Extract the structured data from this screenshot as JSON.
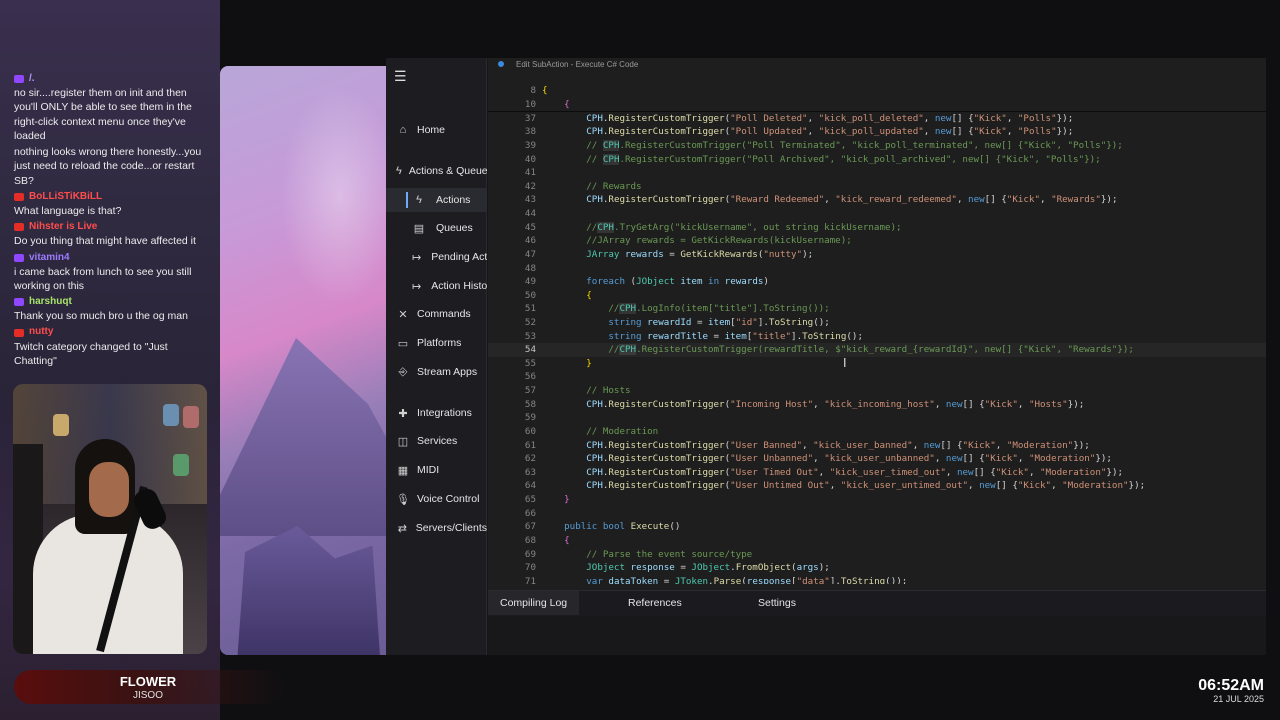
{
  "chat": [
    {
      "platform": "twitch",
      "user": "/.",
      "user_color": "#b497ff",
      "text": "no sir....register them on init and then you'll ONLY be able to see them in the right-click context menu once they've loaded"
    },
    {
      "platform": "",
      "user": "",
      "user_color": "#ffffff",
      "text": "nothing looks wrong there honestly...you just need to reload the code...or restart SB?"
    },
    {
      "platform": "youtube",
      "user": "BoLLiSTiKBiLL",
      "user_color": "#ff4d4d",
      "text": "What language is that?"
    },
    {
      "platform": "youtube",
      "user": "Nihster is Live",
      "user_color": "#ff4d4d",
      "text": "Do you thing that might have affected it"
    },
    {
      "platform": "twitch",
      "user": "vitamin4",
      "user_color": "#9c7bff",
      "text": "i came back from lunch to see you still working on this"
    },
    {
      "platform": "twitch",
      "user": "harshuqt",
      "user_color": "#a6e36b",
      "text": "Thank you so much bro u the og man"
    },
    {
      "platform": "youtube",
      "user": "nutty",
      "user_color": "#ff4d4d",
      "text": "Twitch category changed to \"Just Chatting\""
    }
  ],
  "now_playing": {
    "title": "FLOWER",
    "artist": "JISOO"
  },
  "clock": {
    "time": "06:52AM",
    "date": "21 JUL 2025"
  },
  "sidebar": {
    "items": [
      {
        "label": "Home",
        "icon": "home-icon",
        "glyph": "⌂",
        "sub": false,
        "active": false
      },
      {
        "label": "Actions & Queues",
        "icon": "bolt-icon",
        "glyph": "ϟ",
        "sub": false,
        "active": false
      },
      {
        "label": "Actions",
        "icon": "bolt-icon",
        "glyph": "ϟ",
        "sub": true,
        "active": true
      },
      {
        "label": "Queues",
        "icon": "queue-icon",
        "glyph": "▤",
        "sub": true,
        "active": false
      },
      {
        "label": "Pending Actions",
        "icon": "pending-icon",
        "glyph": "↦",
        "sub": true,
        "active": false
      },
      {
        "label": "Action History",
        "icon": "history-icon",
        "glyph": "↦",
        "sub": true,
        "active": false
      },
      {
        "label": "Commands",
        "icon": "commands-icon",
        "glyph": "✕",
        "sub": false,
        "active": false
      },
      {
        "label": "Platforms",
        "icon": "platforms-icon",
        "glyph": "▭",
        "sub": false,
        "active": false
      },
      {
        "label": "Stream Apps",
        "icon": "stream-apps-icon",
        "glyph": "⎆",
        "sub": false,
        "active": false
      },
      {
        "label": "Integrations",
        "icon": "integrations-icon",
        "glyph": "✚",
        "sub": false,
        "active": false
      },
      {
        "label": "Services",
        "icon": "services-icon",
        "glyph": "◫",
        "sub": false,
        "active": false
      },
      {
        "label": "MIDI",
        "icon": "midi-icon",
        "glyph": "▦",
        "sub": false,
        "active": false
      },
      {
        "label": "Voice Control",
        "icon": "voice-icon",
        "glyph": "🎙",
        "sub": false,
        "active": false
      },
      {
        "label": "Servers/Clients",
        "icon": "servers-icon",
        "glyph": "⇄",
        "sub": false,
        "active": false
      }
    ]
  },
  "editor": {
    "title": "Edit SubAction - Execute C# Code",
    "lines": [
      {
        "n": "8",
        "html": "<span class='br'>{</span>"
      },
      {
        "n": "10",
        "html": "    <span class='br2'>{</span>"
      },
      {
        "n": "37",
        "html": "        <span class='vr'>CPH</span>.<span class='fn'>RegisterCustomTrigger</span>(<span class='st'>\"Poll Deleted\"</span>, <span class='st'>\"kick_poll_deleted\"</span>, <span class='kw'>new</span>[] {<span class='st'>\"Kick\"</span>, <span class='st'>\"Polls\"</span>});"
      },
      {
        "n": "38",
        "html": "        <span class='vr'>CPH</span>.<span class='fn'>RegisterCustomTrigger</span>(<span class='st'>\"Poll Updated\"</span>, <span class='st'>\"kick_poll_updated\"</span>, <span class='kw'>new</span>[] {<span class='st'>\"Kick\"</span>, <span class='st'>\"Polls\"</span>});"
      },
      {
        "n": "39",
        "html": "        <span class='cm'>// <span class='cph'>CPH</span>.RegisterCustomTrigger(\"Poll Terminated\", \"kick_poll_terminated\", new[] {\"Kick\", \"Polls\"});</span>"
      },
      {
        "n": "40",
        "html": "        <span class='cm'>// <span class='cph'>CPH</span>.RegisterCustomTrigger(\"Poll Archived\", \"kick_poll_archived\", new[] {\"Kick\", \"Polls\"});</span>"
      },
      {
        "n": "41",
        "html": ""
      },
      {
        "n": "42",
        "html": "        <span class='cm'>// Rewards</span>"
      },
      {
        "n": "43",
        "html": "        <span class='vr'>CPH</span>.<span class='fn'>RegisterCustomTrigger</span>(<span class='st'>\"Reward Redeemed\"</span>, <span class='st'>\"kick_reward_redeemed\"</span>, <span class='kw'>new</span>[] {<span class='st'>\"Kick\"</span>, <span class='st'>\"Rewards\"</span>});"
      },
      {
        "n": "44",
        "html": ""
      },
      {
        "n": "45",
        "html": "        <span class='cm'>//<span class='cph'>CPH</span>.TryGetArg(\"kickUsername\", out string kickUsername);</span>"
      },
      {
        "n": "46",
        "html": "        <span class='cm'>//JArray rewards = GetKickRewards(kickUsername);</span>"
      },
      {
        "n": "47",
        "html": "        <span class='ty'>JArray</span> <span class='vr'>rewards</span> = <span class='fn'>GetKickRewards</span>(<span class='st'>\"nutty\"</span>);"
      },
      {
        "n": "48",
        "html": ""
      },
      {
        "n": "49",
        "html": "        <span class='kw'>foreach</span> (<span class='ty'>JObject</span> <span class='vr'>item</span> <span class='kw'>in</span> <span class='vr'>rewards</span>)"
      },
      {
        "n": "50",
        "html": "        <span class='br'>{</span>"
      },
      {
        "n": "51",
        "html": "            <span class='cm'>//<span class='cph'>CPH</span>.LogInfo(item[\"title\"].ToString());</span>"
      },
      {
        "n": "52",
        "html": "            <span class='kw'>string</span> <span class='vr'>rewardId</span> = <span class='vr'>item</span>[<span class='st'>\"id\"</span>].<span class='fn'>ToString</span>();"
      },
      {
        "n": "53",
        "html": "            <span class='kw'>string</span> <span class='vr'>rewardTitle</span> = <span class='vr'>item</span>[<span class='st'>\"title\"</span>].<span class='fn'>ToString</span>();"
      },
      {
        "n": "54",
        "html": "            <span class='cm'>//<span class='cph'>CPH</span>.RegisterCustomTrigger(rewardTitle, $\"kick_reward_{rewardId}\", new[] {\"Kick\", \"Rewards\"});</span>",
        "active": true
      },
      {
        "n": "55",
        "html": "        <span class='br'>}</span>"
      },
      {
        "n": "56",
        "html": ""
      },
      {
        "n": "57",
        "html": "        <span class='cm'>// Hosts</span>"
      },
      {
        "n": "58",
        "html": "        <span class='vr'>CPH</span>.<span class='fn'>RegisterCustomTrigger</span>(<span class='st'>\"Incoming Host\"</span>, <span class='st'>\"kick_incoming_host\"</span>, <span class='kw'>new</span>[] {<span class='st'>\"Kick\"</span>, <span class='st'>\"Hosts\"</span>});"
      },
      {
        "n": "59",
        "html": ""
      },
      {
        "n": "60",
        "html": "        <span class='cm'>// Moderation</span>"
      },
      {
        "n": "61",
        "html": "        <span class='vr'>CPH</span>.<span class='fn'>RegisterCustomTrigger</span>(<span class='st'>\"User Banned\"</span>, <span class='st'>\"kick_user_banned\"</span>, <span class='kw'>new</span>[] {<span class='st'>\"Kick\"</span>, <span class='st'>\"Moderation\"</span>});"
      },
      {
        "n": "62",
        "html": "        <span class='vr'>CPH</span>.<span class='fn'>RegisterCustomTrigger</span>(<span class='st'>\"User Unbanned\"</span>, <span class='st'>\"kick_user_unbanned\"</span>, <span class='kw'>new</span>[] {<span class='st'>\"Kick\"</span>, <span class='st'>\"Moderation\"</span>});"
      },
      {
        "n": "63",
        "html": "        <span class='vr'>CPH</span>.<span class='fn'>RegisterCustomTrigger</span>(<span class='st'>\"User Timed Out\"</span>, <span class='st'>\"kick_user_timed_out\"</span>, <span class='kw'>new</span>[] {<span class='st'>\"Kick\"</span>, <span class='st'>\"Moderation\"</span>});"
      },
      {
        "n": "64",
        "html": "        <span class='vr'>CPH</span>.<span class='fn'>RegisterCustomTrigger</span>(<span class='st'>\"User Untimed Out\"</span>, <span class='st'>\"kick_user_untimed_out\"</span>, <span class='kw'>new</span>[] {<span class='st'>\"Kick\"</span>, <span class='st'>\"Moderation\"</span>});"
      },
      {
        "n": "65",
        "html": "    <span class='br2'>}</span>"
      },
      {
        "n": "66",
        "html": ""
      },
      {
        "n": "67",
        "html": "    <span class='kw'>public</span> <span class='kw'>bool</span> <span class='fn'>Execute</span>()"
      },
      {
        "n": "68",
        "html": "    <span class='br2'>{</span>"
      },
      {
        "n": "69",
        "html": "        <span class='cm'>// Parse the event source/type</span>"
      },
      {
        "n": "70",
        "html": "        <span class='ty'>JObject</span> <span class='vr'>response</span> = <span class='ty'>JObject</span>.<span class='fn'>FromObject</span>(<span class='vr'>args</span>);"
      },
      {
        "n": "71",
        "html": "        <span class='kw'>var</span> <span class='vr'>dataToken</span> = <span class='ty'>JToken</span>.<span class='fn'>Parse</span>(<span class='vr'>response</span>[<span class='st'>\"data\"</span>].<span class='fn'>ToString</span>());"
      }
    ]
  },
  "bottom_tabs": [
    {
      "label": "Compiling Log",
      "active": true
    },
    {
      "label": "References",
      "active": false
    },
    {
      "label": "Settings",
      "active": false
    }
  ]
}
